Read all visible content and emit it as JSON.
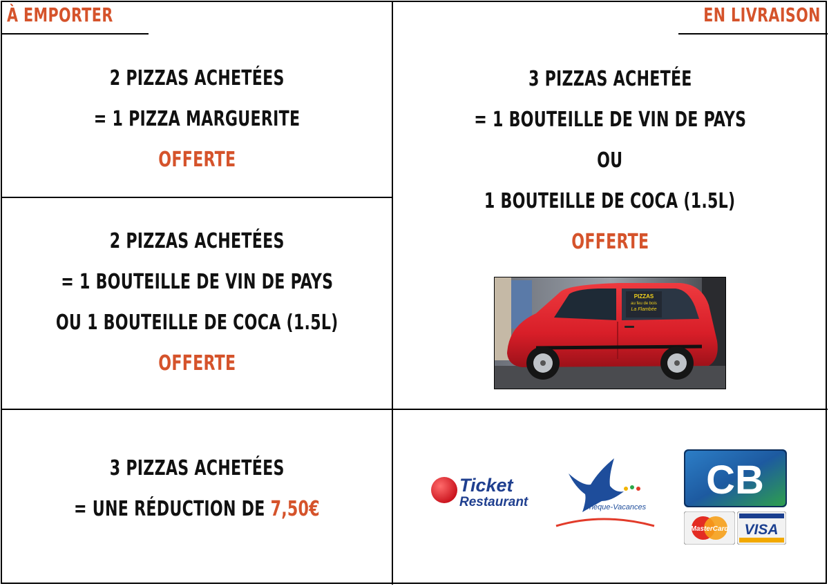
{
  "headers": {
    "takeaway": "À EMPORTER",
    "delivery": "EN LIVRAISON"
  },
  "offers": {
    "takeaway_1": {
      "line1": "2 PIZZAS ACHETÉES",
      "line2": "= 1 PIZZA MARGUERITE",
      "line3": "OFFERTE"
    },
    "takeaway_2": {
      "line1": "2 PIZZAS ACHETÉES",
      "line2": "= 1 BOUTEILLE DE VIN DE PAYS",
      "line3": "OU 1 BOUTEILLE DE COCA (1.5L)",
      "line4": "OFFERTE"
    },
    "takeaway_3": {
      "line1": "3 PIZZAS ACHETÉES",
      "line2_prefix": "= UNE RÉDUCTION DE ",
      "amount": "7,50€"
    },
    "delivery": {
      "line1": "3 PIZZAS ACHETÉE",
      "line2": "= 1 BOUTEILLE DE VIN DE PAYS",
      "line3": "OU",
      "line4": "1 BOUTEILLE DE COCA (1.5L)",
      "line5": "OFFERTE"
    }
  },
  "car_photo": {
    "sign_line1": "PIZZAS",
    "sign_line2": "au feu de bois",
    "sign_line3": "La Flambée",
    "car_color": "#d81e28"
  },
  "payment_logos": {
    "ticket_line1": "Ticket",
    "ticket_line2": "Restaurant",
    "cheque": "Chèque-Vacances",
    "cb": "CB",
    "mastercard": "MasterCard",
    "visa": "VISA"
  },
  "colors": {
    "accent": "#d5532b",
    "text": "#111111",
    "border": "#000000"
  }
}
